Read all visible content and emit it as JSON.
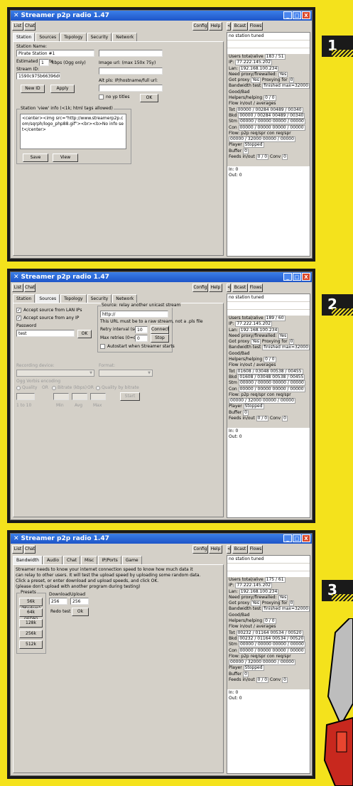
{
  "app": {
    "title": "Streamer p2p radio 1.47",
    "btn_list": "List",
    "btn_chat": "Chat",
    "btn_config": "Config",
    "btn_help": "Help",
    "btn_back": "<",
    "btn_bcast": "Bcast",
    "btn_flows": "Flows",
    "no_station": "no station tuned",
    "win_min": "_",
    "win_max": "□",
    "win_close": "X"
  },
  "panel_badges": [
    "1",
    "2",
    "3"
  ],
  "stats_labels": {
    "users": "Users total/alive",
    "ip": "IP:",
    "lan": "Lan:",
    "need_proxy": "Need proxy/firewalled:",
    "got_proxy": "Got proxy",
    "proxying_for": "Proxying for",
    "bw_test": "Bandwidth test",
    "good_bad": "Good/Bad",
    "helpers": "Helpers/helping",
    "flow_avg": "Flow in/out / averages",
    "tot": "Tot",
    "bkd": "Bkd",
    "stm": "Stm",
    "con": "Con",
    "flow_p2p": "Flow: p2p req/spr  con req/spr",
    "player": "Player",
    "buffer": "Buffer",
    "feeds": "Feeds in/out",
    "conv": "Conv",
    "in": "In: 0",
    "out": "Out: 0"
  },
  "panel1": {
    "tabs": [
      "Station",
      "Sources",
      "Topology",
      "Security",
      "Network"
    ],
    "station_name_label": "Station Name:",
    "station_name": "Pirate Station #1",
    "estimated_label": "Estimated bitrate",
    "bitrate": "1",
    "kbps_label": "kbps (Ogg only)",
    "image_url_label": "Image url: (max 150x 75y)",
    "stream_id_label": "Stream ID:",
    "stream_id": "1590c975b66396d0",
    "alt_pls_label": "Alt pls: IP/hostname/full url:",
    "new_id": "New ID",
    "apply": "Apply",
    "no_yp_titles": "no yp titles",
    "ok": "OK",
    "view_info_label": "Station 'view' info (<1k; html tags allowed)",
    "view_info": "<center><img src=\"http://www.streamerp2p.com/sqrph/logo_php88.gif\"><br><b>No info set</center>",
    "save": "Save",
    "view": "View",
    "stats": {
      "users": "183 / 51",
      "ip": "77.222.145.202",
      "lan": "192.168.100.234",
      "need_proxy": "Yes",
      "got_proxy": "Yes",
      "proxying_for": "0",
      "bw_test": "finished max=32000",
      "helpers": "0 / 0",
      "tot": "00000 / 00284   00489 / 00340",
      "bkd": "00000 / 00284   00489 / 00340",
      "stm": "00000 / 00000   00000 / 00000",
      "con": "00000 / 00000   00000 / 00000",
      "flow_p2p": "00000 / 32000   00000 / 00000",
      "player": "Stopped",
      "buffer": "0",
      "feeds": "0 / 0",
      "conv": "0"
    }
  },
  "panel2": {
    "tabs": [
      "Station",
      "Sources",
      "Topology",
      "Security",
      "Network"
    ],
    "accept_lan": "Accept source from LAN IPs",
    "accept_any": "Accept source from any IP",
    "password_label": "Password",
    "password": "test",
    "ok": "OK",
    "relay_group": "Source: relay another unicast stream",
    "relay_url": "http://",
    "raw_note": "This URL must be to a raw stream, not a .pls file",
    "retry_label": "Retry interval (secs):",
    "retry": "10",
    "connect": "Connect",
    "max_retries_label": "Max retries (0=off):",
    "max_retries": "0",
    "stop": "Stop",
    "autostart": "Autostart when Streamer starts",
    "recording_label": "Recording device:",
    "format_label": "Format:",
    "ogg_label": "Ogg Vorbis encoding",
    "quality": "Quality",
    "or1": "OR",
    "bitrate_kbps": "Bitrate (kbps)",
    "or2": "OR",
    "quality_bitrate": "Quality by bitrate",
    "start": "Start",
    "range": "1 to 10",
    "min": "Min",
    "avg": "Avg",
    "max": "Max",
    "stats": {
      "users": "189 / 60",
      "ip": "77.222.145.202",
      "lan": "192.168.100.234",
      "need_proxy": "Yes",
      "got_proxy": "Yes",
      "proxying_for": "0",
      "bw_test": "finished max=32000",
      "helpers": "0 / 0",
      "tot": "01608 / 03048   00538 / 00455",
      "bkd": "01608 / 03048   00538 / 00455",
      "stm": "00000 / 00000   00000 / 00000",
      "con": "00000 / 00000   00000 / 00000",
      "flow_p2p": "00000 / 32000   00000 / 00000",
      "player": "Stopped",
      "buffer": "0",
      "feeds": "0 / 0",
      "conv": "0"
    }
  },
  "panel3": {
    "tabs": [
      "Bandwidth",
      "Audio",
      "Chat",
      "Misc",
      "IP/Ports",
      "Game"
    ],
    "info1": "Streamer needs to know your internet connection speed to know how much data it",
    "info2": "can relay to other users. It will test the upload speed by uploading some random data.",
    "info3": "Click a preset, or enter download and upload speeds, and click OK.",
    "info4": "(please don't upload with another program during testing)",
    "presets_label": "Presets",
    "download_label": "Download",
    "upload_label": "Upload",
    "download": "256",
    "upload": "256",
    "redo": "Redo test",
    "ok": "Ok",
    "presets": [
      "56k (Modem)",
      "64k (ISDN)",
      "128k",
      "256k",
      "512k"
    ],
    "stats": {
      "users": "175 / 61",
      "ip": "77.222.145.202",
      "lan": "192.168.100.234",
      "need_proxy": "Yes",
      "got_proxy": "Yes",
      "proxying_for": "0",
      "bw_test": "finished max=32000",
      "helpers": "0 / 0",
      "tot": "00232 / 01164   00534 / 00520",
      "bkd": "00232 / 01164   00534 / 00520",
      "stm": "00000 / 00000   00000 / 00000",
      "con": "00000 / 00000   00000 / 00000",
      "flow_p2p": "00000 / 32000   00000 / 00000",
      "player": "Stopped",
      "buffer": "0",
      "feeds": "0 / 0",
      "conv": "0"
    }
  }
}
